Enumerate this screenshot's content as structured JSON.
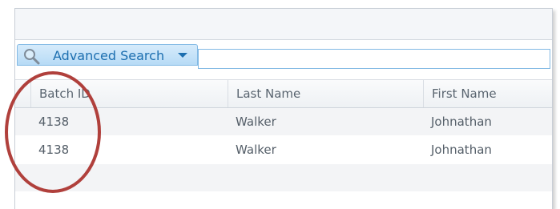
{
  "search": {
    "advanced_label": "Advanced Search",
    "icon": "magnifier-icon",
    "dropdown_icon": "caret-down-icon",
    "input_value": ""
  },
  "grid": {
    "columns": [
      "Batch ID",
      "Last Name",
      "First Name"
    ],
    "rows": [
      {
        "batch_id": "4138",
        "last_name": "Walker",
        "first_name": "Johnathan"
      },
      {
        "batch_id": "4138",
        "last_name": "Walker",
        "first_name": "Johnathan"
      }
    ]
  },
  "colors": {
    "accent": "#1d6fb0",
    "tab_bg": "#c6e3f8",
    "annotation_circle": "#b0403c"
  }
}
